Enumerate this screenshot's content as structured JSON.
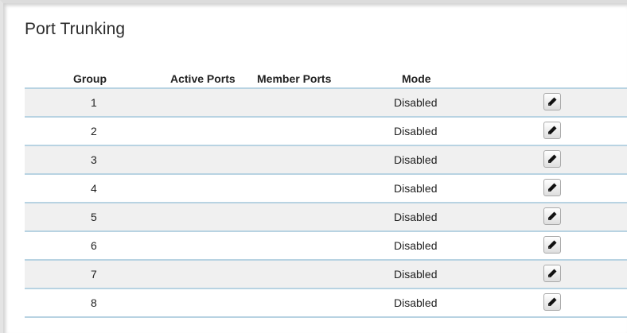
{
  "page": {
    "title": "Port Trunking"
  },
  "table": {
    "columns": {
      "group": "Group",
      "active_ports": "Active Ports",
      "member_ports": "Member Ports",
      "mode": "Mode"
    },
    "rows": [
      {
        "group": "1",
        "active_ports": "",
        "member_ports": "",
        "mode": "Disabled"
      },
      {
        "group": "2",
        "active_ports": "",
        "member_ports": "",
        "mode": "Disabled"
      },
      {
        "group": "3",
        "active_ports": "",
        "member_ports": "",
        "mode": "Disabled"
      },
      {
        "group": "4",
        "active_ports": "",
        "member_ports": "",
        "mode": "Disabled"
      },
      {
        "group": "5",
        "active_ports": "",
        "member_ports": "",
        "mode": "Disabled"
      },
      {
        "group": "6",
        "active_ports": "",
        "member_ports": "",
        "mode": "Disabled"
      },
      {
        "group": "7",
        "active_ports": "",
        "member_ports": "",
        "mode": "Disabled"
      },
      {
        "group": "8",
        "active_ports": "",
        "member_ports": "",
        "mode": "Disabled"
      }
    ],
    "row_action_icon": "pencil-icon"
  },
  "colors": {
    "row_divider": "#b8d3e2",
    "row_alt_background": "#f0f0f0"
  }
}
